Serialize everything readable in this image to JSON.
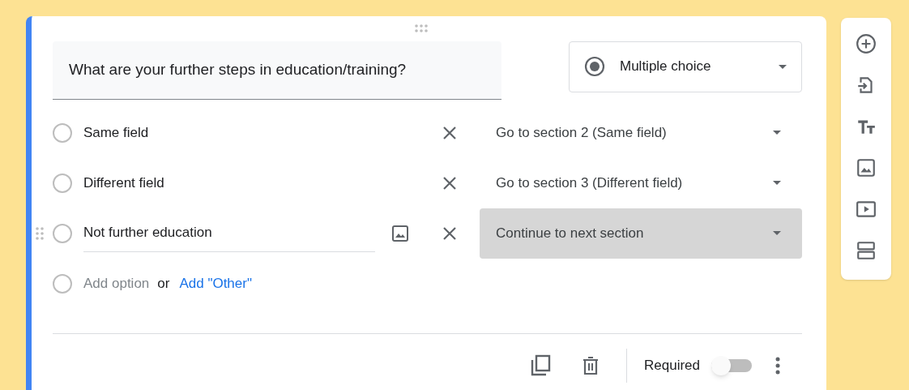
{
  "question": {
    "title": "What are your further steps in education/training?",
    "type_label": "Multiple choice"
  },
  "options": [
    {
      "label": "Same field",
      "destination": "Go to section 2 (Same field)",
      "focused": false
    },
    {
      "label": "Different field",
      "destination": "Go to section 3 (Different field)",
      "focused": false
    },
    {
      "label": "Not further education",
      "destination": "Continue to next section",
      "focused": true
    }
  ],
  "add_option": {
    "label": "Add option",
    "separator": "or",
    "other_link": "Add \"Other\""
  },
  "footer": {
    "required_label": "Required",
    "required": false
  }
}
